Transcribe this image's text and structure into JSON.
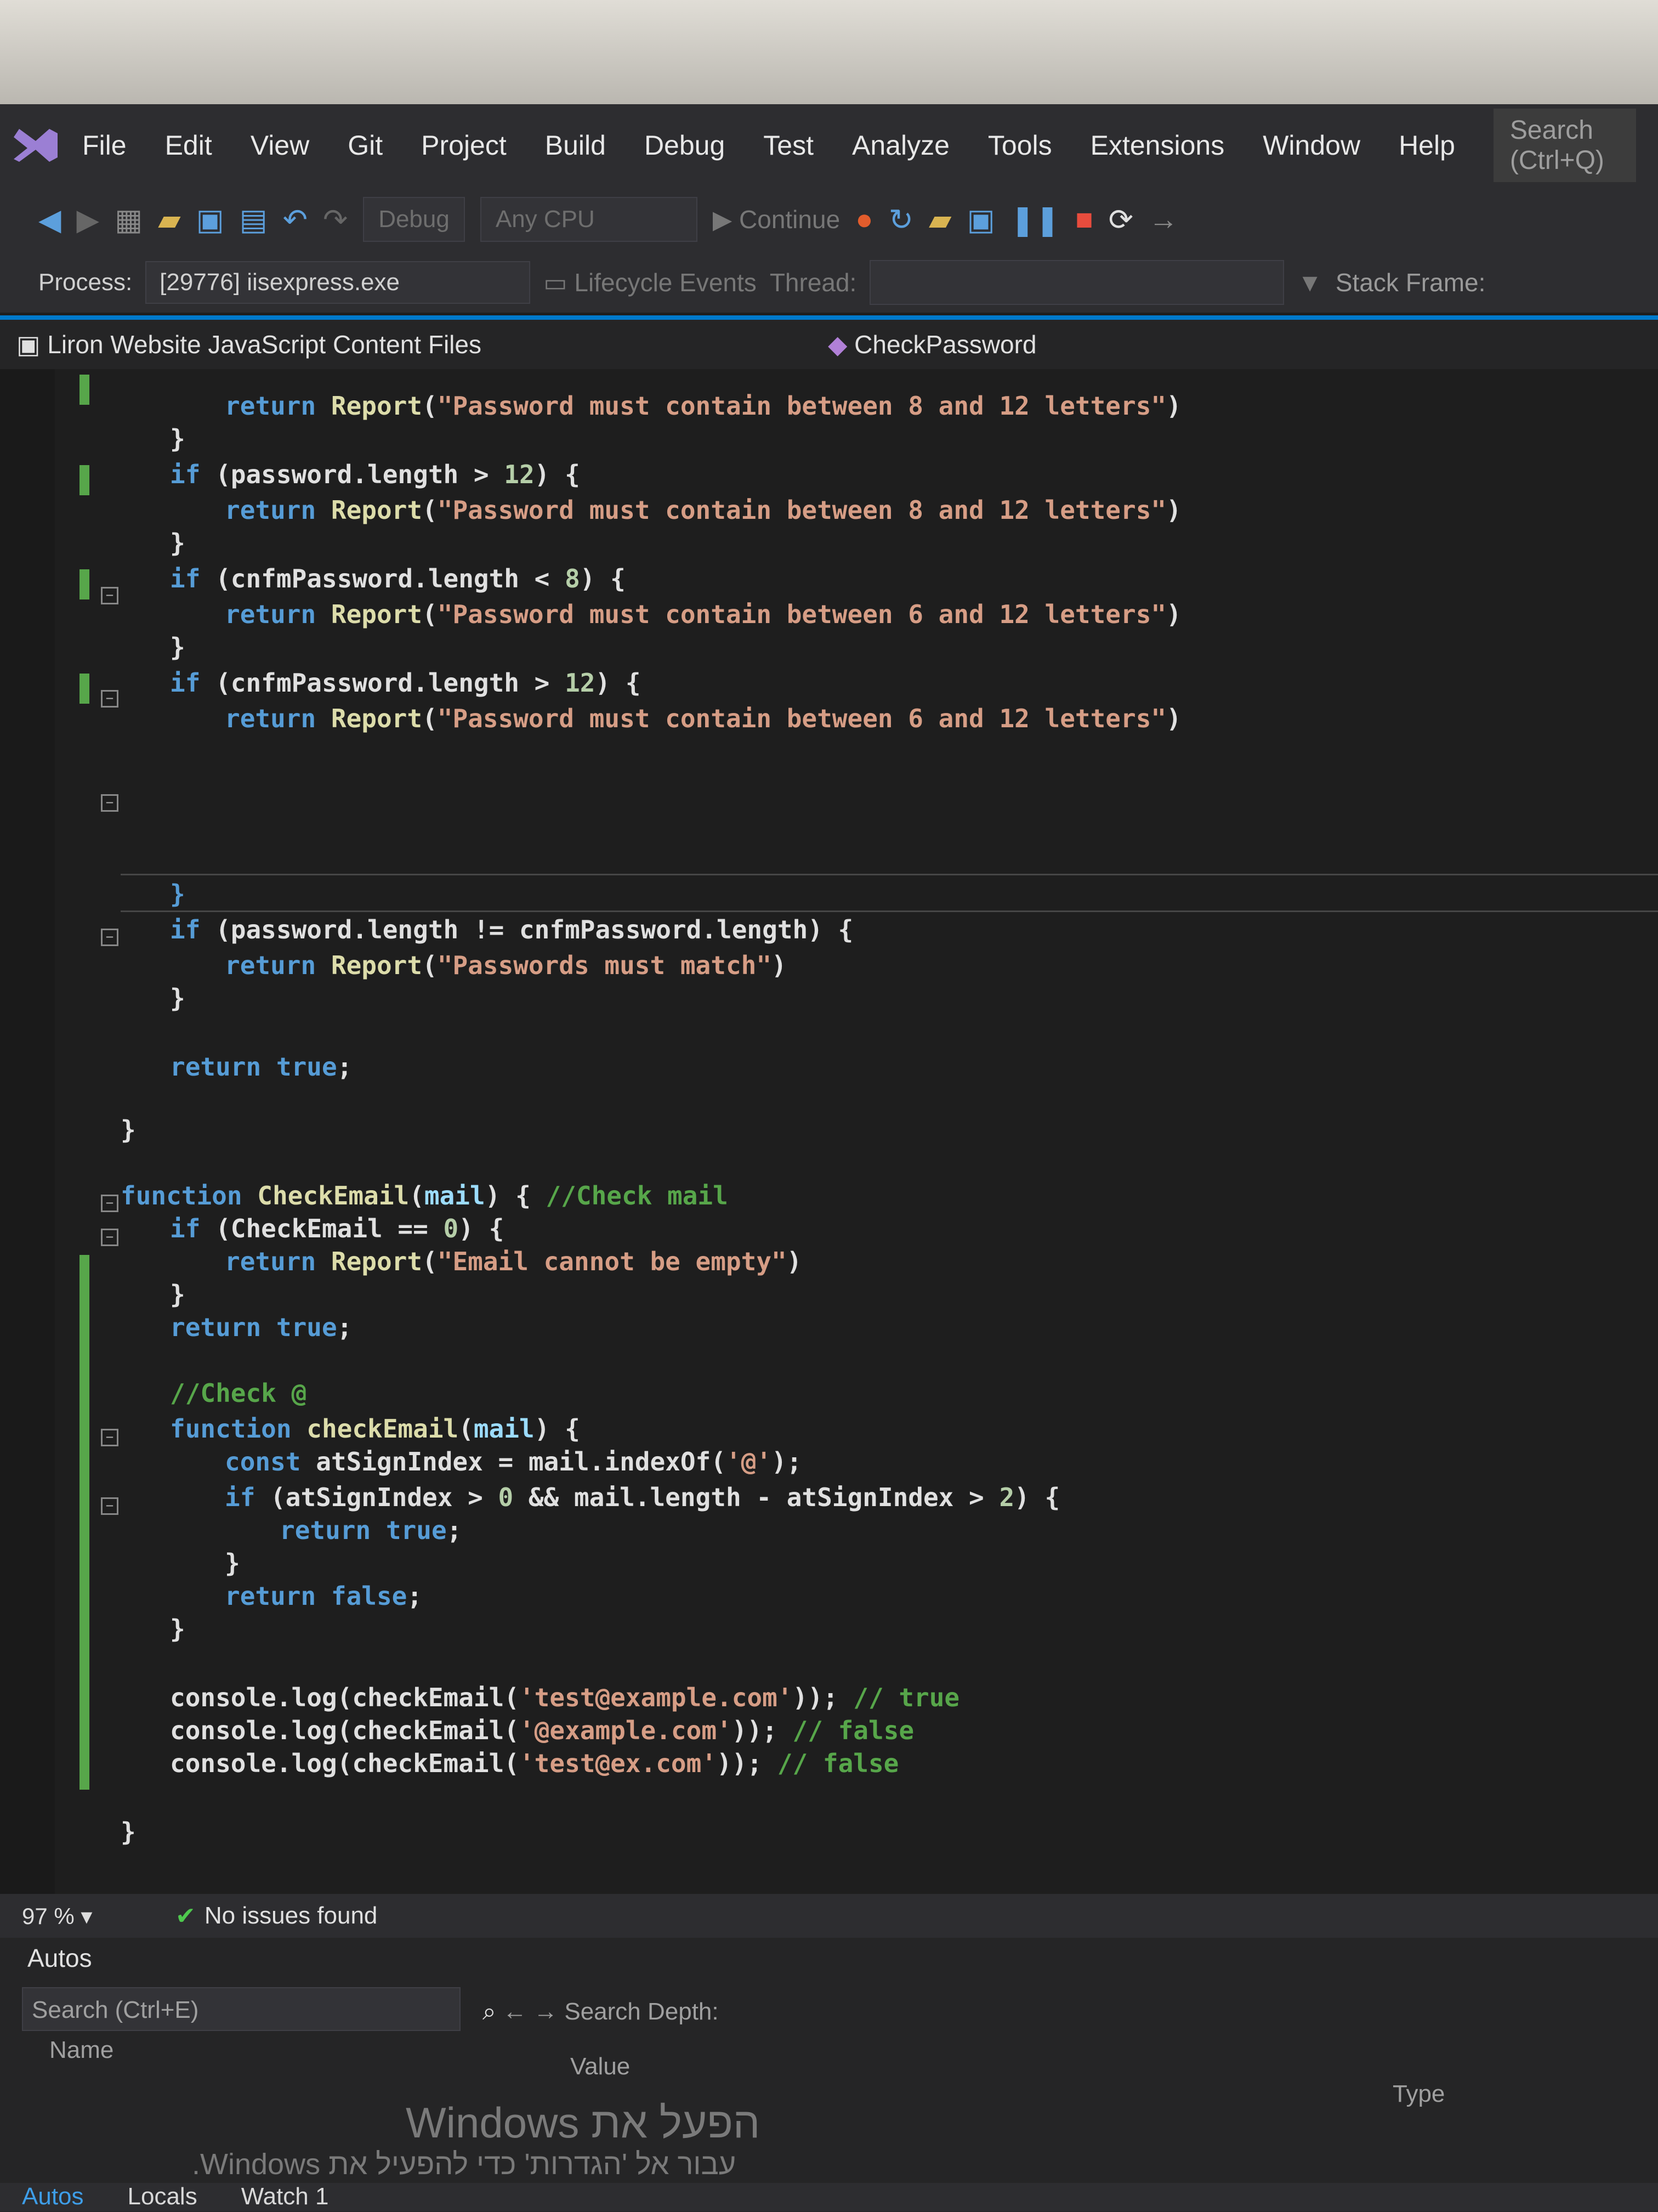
{
  "menubar": {
    "items": [
      "File",
      "Edit",
      "View",
      "Git",
      "Project",
      "Build",
      "Debug",
      "Test",
      "Analyze",
      "Tools",
      "Extensions",
      "Window",
      "Help"
    ],
    "search": "Search (Ctrl+Q)"
  },
  "toolbar": {
    "config": "Debug",
    "platform": "Any CPU",
    "continue": "Continue",
    "stack_frame": "Stack Frame:"
  },
  "procbar": {
    "process_label": "Process:",
    "process_value": "[29776] iisexpress.exe",
    "lifecycle": "Lifecycle Events",
    "thread": "Thread:"
  },
  "navbar": {
    "project": "Liron Website JavaScript Content Files",
    "member": "CheckPassword"
  },
  "status": {
    "zoom": "97 %",
    "issues": "No issues found"
  },
  "autos": {
    "title": "Autos",
    "search_placeholder": "Search (Ctrl+E)",
    "search_depth": "Search Depth:",
    "col_name": "Name",
    "col_value": "Value",
    "col_type": "Type"
  },
  "watermark": {
    "line1": "הפעל את Windows",
    "line2": "עבור אל 'הגדרות' כדי להפעיל את Windows."
  },
  "tabs": [
    "Autos",
    "Locals",
    "Watch 1"
  ],
  "colors": {
    "accent": "#007acc",
    "keyword": "#569cd6",
    "string": "#d69d85",
    "comment": "#57a64a"
  }
}
